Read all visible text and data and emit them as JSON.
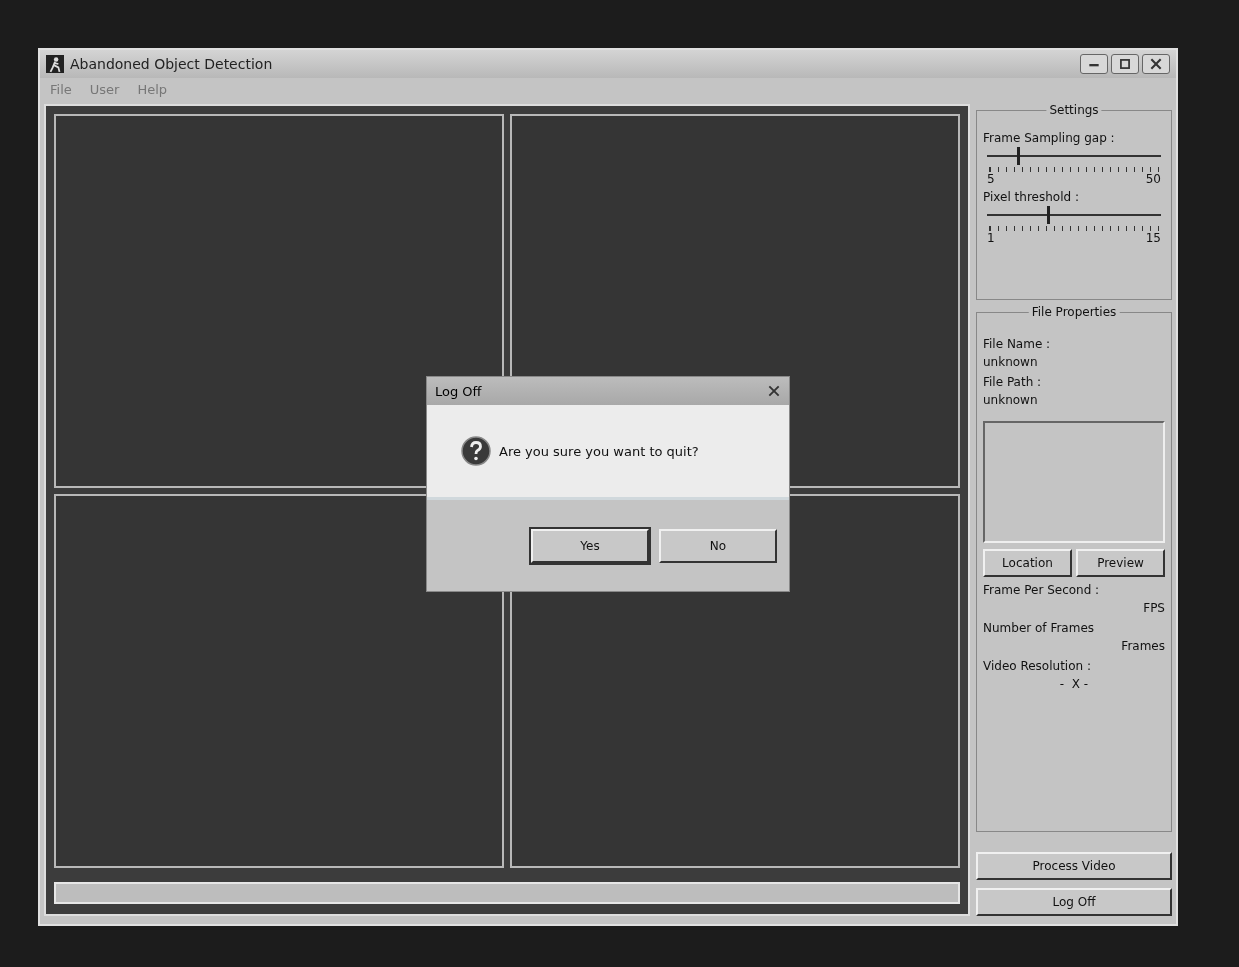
{
  "window": {
    "title": "Abandoned Object Detection"
  },
  "menu": [
    {
      "label": "File"
    },
    {
      "label": "User"
    },
    {
      "label": "Help"
    }
  ],
  "settings": {
    "title": "Settings",
    "sliders": [
      {
        "label": "Frame Sampling gap :",
        "level": 0.18,
        "min": "5",
        "max": "50"
      },
      {
        "label": "Pixel threshold :",
        "level": 0.35,
        "min": "1",
        "max": "15"
      }
    ]
  },
  "file_properties": {
    "title": "File Properties",
    "fields": [
      {
        "label": "File Name :",
        "value": "unknown"
      },
      {
        "label": "File Path :",
        "value": "unknown"
      }
    ],
    "buttons": [
      "Location",
      "Preview"
    ],
    "stats": [
      {
        "label": "Frame Per Second :",
        "value": "FPS"
      },
      {
        "label": "Number of Frames",
        "value": "Frames"
      },
      {
        "label": "Video Resolution :",
        "value": "-  X -"
      }
    ]
  },
  "actions": [
    "Process Video",
    "Log Off"
  ],
  "dialog": {
    "title": "Log Off",
    "message": "Are you sure you want to quit?",
    "buttons": [
      {
        "label": "Yes",
        "selected": true
      },
      {
        "label": "No",
        "selected": false
      }
    ]
  }
}
